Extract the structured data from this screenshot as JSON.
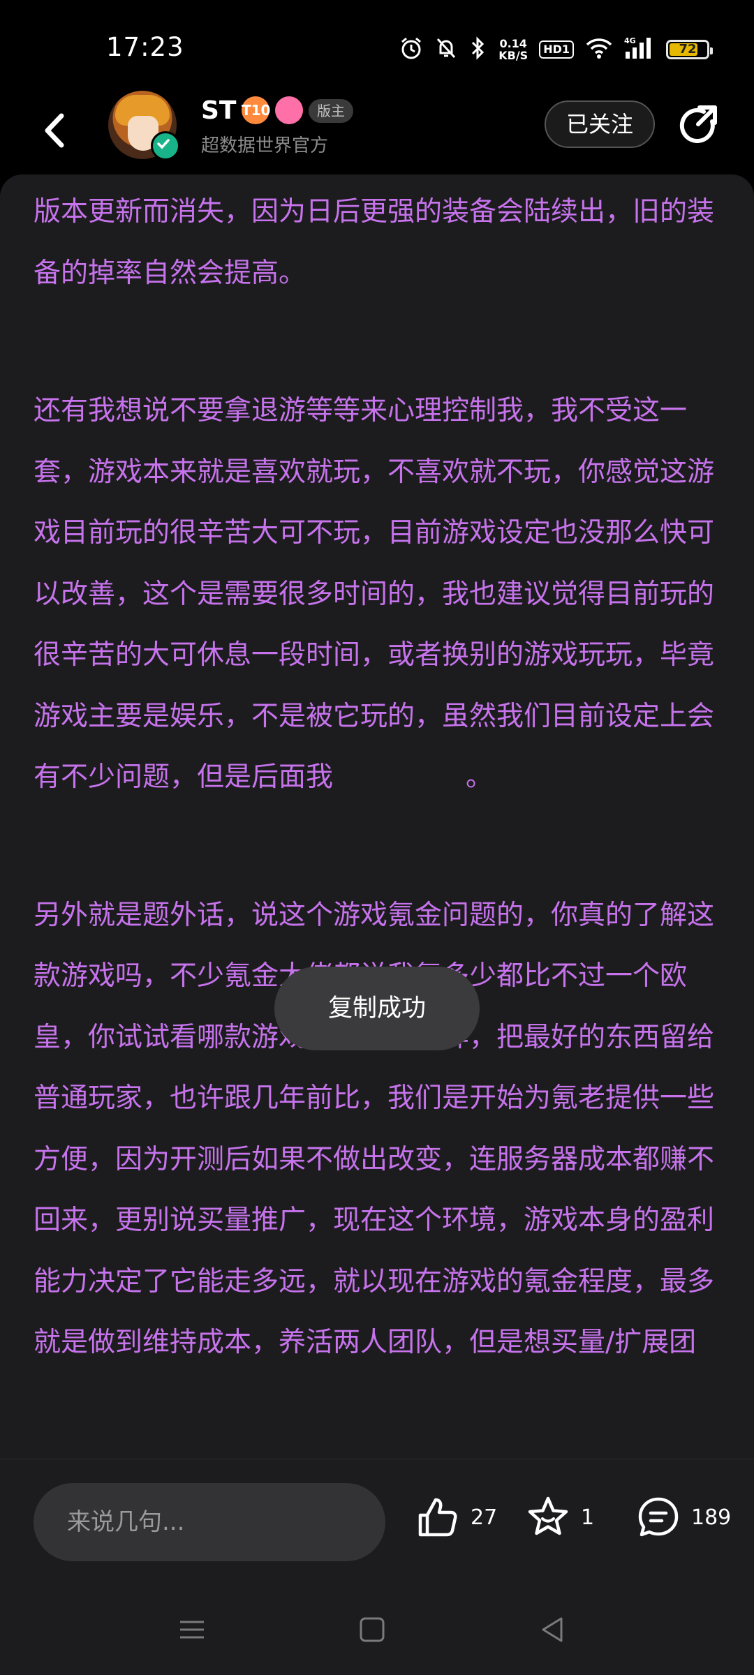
{
  "status_bar": {
    "time": "17:23",
    "net_speed_value": "0.14",
    "net_speed_unit": "KB/S",
    "hd_label": "HD1",
    "signal_label": "4G",
    "battery": "72",
    "icons": [
      "alarm-icon",
      "mute-icon",
      "bluetooth-icon",
      "wifi-icon",
      "signal-icon",
      "battery-icon"
    ]
  },
  "header": {
    "username": "ST",
    "level_badge": "T10",
    "role_badge": "版主",
    "subtitle": "超数据世界官方",
    "follow_label": "已关注"
  },
  "article": {
    "paragraphs": [
      "版本更新而消失，因为日后更强的装备会陆续出，旧的装备的掉率自然会提高。",
      "还有我想说不要拿退游等等来心理控制我，我不受这一套，游戏本来就是喜欢就玩，不喜欢就不玩，你感觉这游戏目前玩的很辛苦大可不玩，目前游戏设定也没那么快可以改善，这个是需要很多时间的，我也建议觉得目前玩的很辛苦的大可休息一段时间，或者换别的游戏玩玩，毕竟游戏主要是娱乐，不是被它玩的，虽然我们目前设定上会有不少问题，但是后面我",
      "另外就是题外话，说这个游戏氪金问题的，你真的了解这款游戏吗，不少氪金大佬都说我氪多少都比不过一个欧皇，你试试看哪款游戏敢像我们这样，把最好的东西留给普通玩家，也许跟几年前比，我们是开始为氪老提供一些方便，因为开测后如果不做出改变，连服务器成本都赚不回来，更别说买量推广，现在这个环境，游戏本身的盈利能力决定了它能走多远，就以现在游戏的氪金程度，最多就是做到维持成本，养活两人团队，但是想买量/扩展团"
    ],
    "para2_tail": "。"
  },
  "toast": "复制成功",
  "bottom_bar": {
    "comment_placeholder": "来说几句...",
    "like_count": "27",
    "favorite_count": "1",
    "comment_count": "189"
  },
  "colors": {
    "text_purple": "#c673ec",
    "background": "#1c1c1e"
  }
}
